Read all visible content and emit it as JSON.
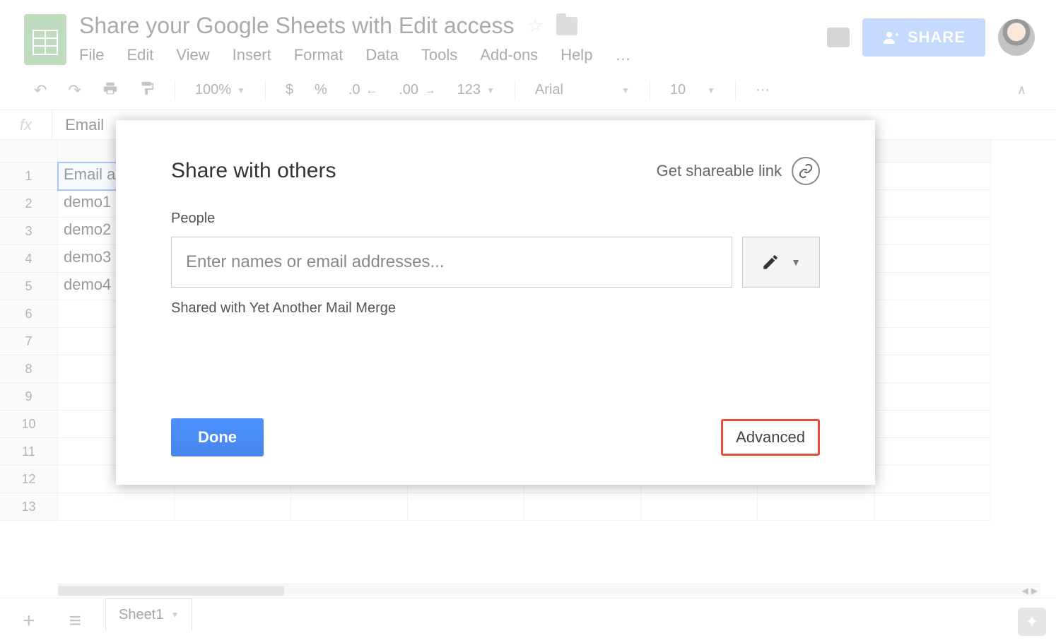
{
  "header": {
    "doc_title": "Share your Google Sheets with Edit access",
    "share_button": "SHARE"
  },
  "menu": {
    "file": "File",
    "edit": "Edit",
    "view": "View",
    "insert": "Insert",
    "format": "Format",
    "data": "Data",
    "tools": "Tools",
    "addons": "Add-ons",
    "help": "Help",
    "more": "…"
  },
  "toolbar": {
    "zoom": "100%",
    "currency": "$",
    "percent": "%",
    "dec_minus": ".0",
    "dec_plus": ".00",
    "numfmt": "123",
    "font": "Arial",
    "font_size": "10",
    "more": "···"
  },
  "formula_bar": {
    "fx": "fx",
    "value": "Email"
  },
  "grid": {
    "row_numbers": [
      "1",
      "2",
      "3",
      "4",
      "5",
      "6",
      "7",
      "8",
      "9",
      "10",
      "11",
      "12",
      "13"
    ],
    "cells_colA": [
      "Email a",
      "demo1",
      "demo2",
      "demo3",
      "demo4",
      "",
      "",
      "",
      "",
      "",
      "",
      "",
      ""
    ]
  },
  "footer": {
    "sheet_tab": "Sheet1"
  },
  "dialog": {
    "title": "Share with others",
    "get_link": "Get shareable link",
    "people_label": "People",
    "input_placeholder": "Enter names or email addresses...",
    "shared_with": "Shared with Yet Another Mail Merge",
    "done": "Done",
    "advanced": "Advanced"
  }
}
